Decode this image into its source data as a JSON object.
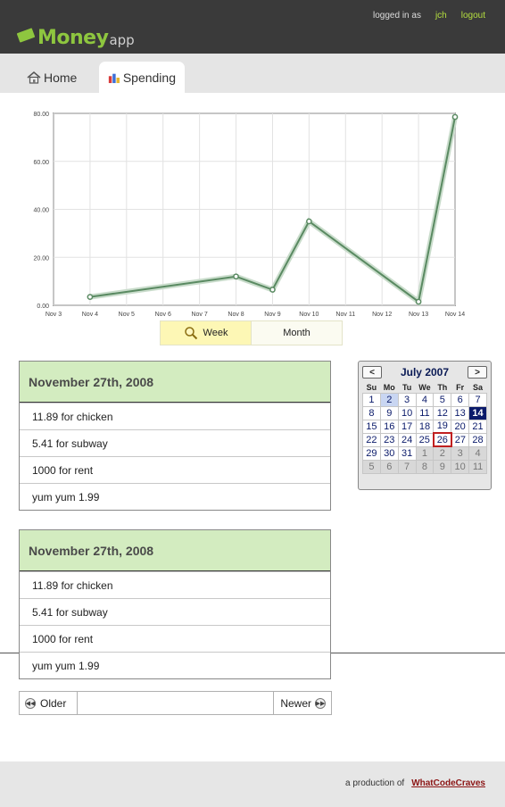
{
  "header": {
    "logo_main": "Money",
    "logo_sub": "app",
    "logged_in_label": "logged in as",
    "username": "jch",
    "logout_label": "logout"
  },
  "tabs": [
    {
      "label": "Home",
      "icon": "house-icon"
    },
    {
      "label": "Spending",
      "icon": "bar-chart-icon"
    }
  ],
  "chart_data": {
    "type": "line",
    "x": [
      "Nov 3",
      "Nov 4",
      "Nov 5",
      "Nov 6",
      "Nov 7",
      "Nov 8",
      "Nov 9",
      "Nov 10",
      "Nov 11",
      "Nov 12",
      "Nov 13",
      "Nov 14"
    ],
    "points": [
      {
        "x": "Nov 4",
        "y": 3.5
      },
      {
        "x": "Nov 8",
        "y": 12
      },
      {
        "x": "Nov 9",
        "y": 6.5
      },
      {
        "x": "Nov 10",
        "y": 35
      },
      {
        "x": "Nov 13",
        "y": 1.5
      },
      {
        "x": "Nov 14",
        "y": 78.5
      }
    ],
    "y_ticks": [
      "0.00",
      "20.00",
      "40.00",
      "60.00",
      "80.00"
    ],
    "ylim": [
      0,
      80
    ],
    "grid": true,
    "line_color": "#5a8a62"
  },
  "range_toggle": {
    "week_label": "Week",
    "month_label": "Month"
  },
  "cards": [
    {
      "date": "November 27th, 2008",
      "items": [
        "11.89 for chicken",
        "5.41 for subway",
        "1000 for rent",
        "yum  yum 1.99"
      ]
    },
    {
      "date": "November 27th, 2008",
      "items": [
        "11.89 for chicken",
        "5.41 for subway",
        "1000 for rent",
        "yum  yum 1.99"
      ]
    }
  ],
  "pager": {
    "older_label": "Older",
    "newer_label": "Newer"
  },
  "calendar": {
    "title": "July 2007",
    "prev": "<",
    "next": ">",
    "weekdays": [
      "Su",
      "Mo",
      "Tu",
      "We",
      "Th",
      "Fr",
      "Sa"
    ],
    "weeks": [
      [
        "1",
        "2",
        "3",
        "4",
        "5",
        "6",
        "7"
      ],
      [
        "8",
        "9",
        "10",
        "11",
        "12",
        "13",
        "14"
      ],
      [
        "15",
        "16",
        "17",
        "18",
        "19",
        "20",
        "21"
      ],
      [
        "22",
        "23",
        "24",
        "25",
        "26",
        "27",
        "28"
      ],
      [
        "29",
        "30",
        "31",
        "1",
        "2",
        "3",
        "4"
      ],
      [
        "5",
        "6",
        "7",
        "8",
        "9",
        "10",
        "11"
      ]
    ],
    "selected_day": "2",
    "today_day": "26",
    "highlight_day": "14"
  },
  "footer": {
    "production_label": "a production of",
    "company": "WhatCodeCraves"
  }
}
